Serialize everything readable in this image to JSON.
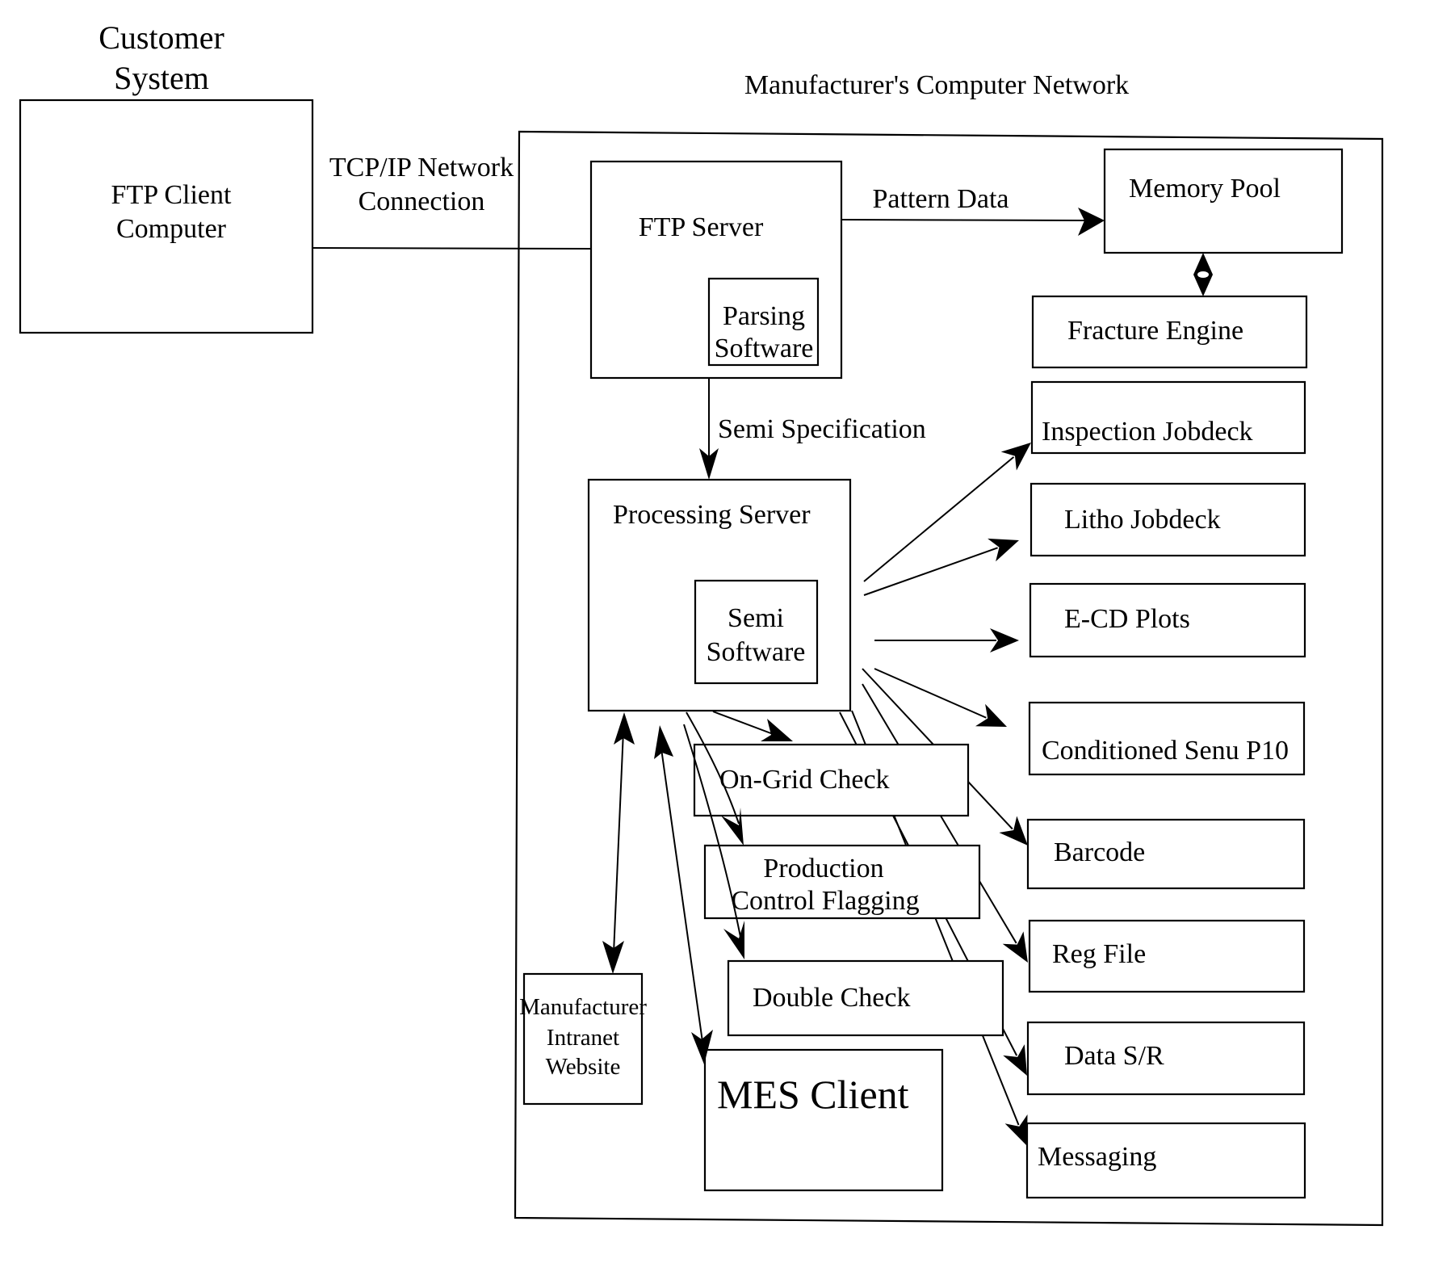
{
  "headings": {
    "customer_system": [
      "Customer",
      "System"
    ],
    "manufacturer_network": "Manufacturer's Computer Network"
  },
  "connections": {
    "tcp_ip": [
      "TCP/IP Network",
      "Connection"
    ],
    "pattern_data": "Pattern Data",
    "semi_specification": "Semi Specification"
  },
  "nodes": {
    "ftp_client": [
      "FTP Client",
      "Computer"
    ],
    "ftp_server": "FTP Server",
    "parsing_software": [
      "Parsing",
      "Software"
    ],
    "memory_pool": "Memory Pool",
    "fracture_engine": "Fracture Engine",
    "processing_server": "Processing Server",
    "semi_software": [
      "Semi",
      "Software"
    ],
    "on_grid_check": "On-Grid Check",
    "production_control_flagging": [
      "Production",
      "Control Flagging"
    ],
    "double_check": "Double Check",
    "intranet_website": [
      "Manufacturer",
      "Intranet",
      "Website"
    ],
    "mes_client": "MES Client"
  },
  "outputs": [
    {
      "id": "inspection-jobdeck",
      "label": "Inspection Jobdeck"
    },
    {
      "id": "litho-jobdeck",
      "label": "Litho Jobdeck"
    },
    {
      "id": "e-cd-plots",
      "label": "E-CD Plots"
    },
    {
      "id": "conditioned-semi-p10",
      "label": "Conditioned Senu P10"
    },
    {
      "id": "barcode",
      "label": "Barcode"
    },
    {
      "id": "reg-file",
      "label": "Reg File"
    },
    {
      "id": "data-s-r",
      "label": "Data S/R"
    },
    {
      "id": "messaging",
      "label": "Messaging"
    }
  ]
}
